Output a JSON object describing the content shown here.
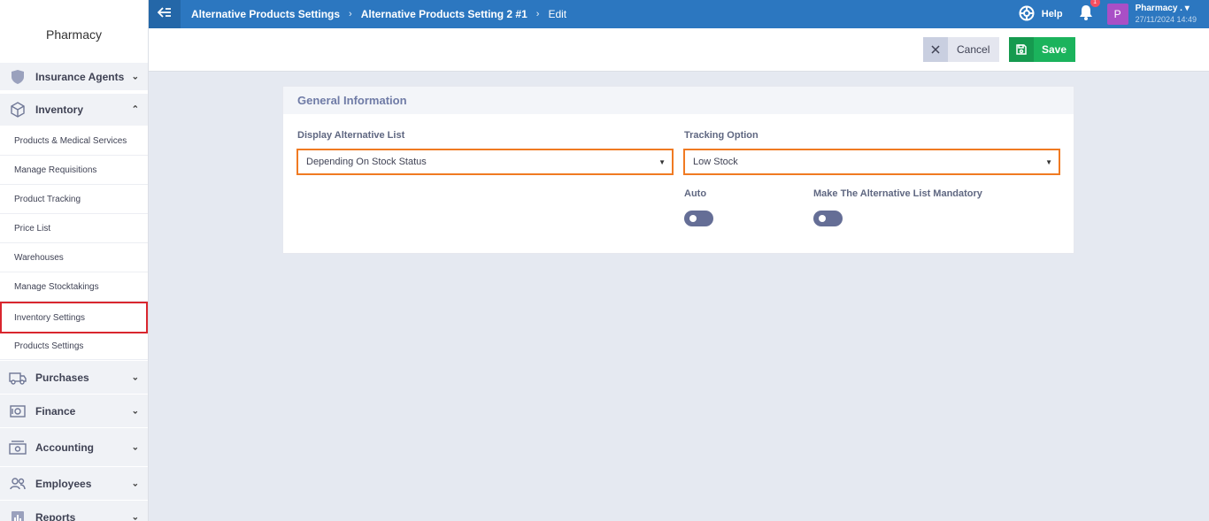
{
  "sidebar": {
    "brand": "Pharmacy",
    "items": [
      {
        "label": "Insurance Agents",
        "icon": "shield-icon"
      },
      {
        "label": "Inventory",
        "icon": "box-icon"
      },
      {
        "label": "Purchases",
        "icon": "truck-icon"
      },
      {
        "label": "Finance",
        "icon": "safe-icon"
      },
      {
        "label": "Accounting",
        "icon": "cash-icon"
      },
      {
        "label": "Employees",
        "icon": "people-icon"
      },
      {
        "label": "Reports",
        "icon": "chart-icon"
      }
    ],
    "sub_items": [
      {
        "label": "Products & Medical Services"
      },
      {
        "label": "Manage Requisitions"
      },
      {
        "label": "Product Tracking"
      },
      {
        "label": "Price List"
      },
      {
        "label": "Warehouses"
      },
      {
        "label": "Manage Stocktakings"
      },
      {
        "label": "Inventory Settings"
      },
      {
        "label": "Products Settings"
      }
    ]
  },
  "topbar": {
    "breadcrumbs": [
      "Alternative Products Settings",
      "Alternative Products Setting 2 #1",
      "Edit"
    ],
    "help": "Help",
    "notification_count": "1",
    "avatar_letter": "P",
    "user_name": "Pharmacy .",
    "datetime": "27/11/2024 14:49"
  },
  "actions": {
    "cancel": "Cancel",
    "save": "Save"
  },
  "form": {
    "section_title": "General Information",
    "display_label": "Display Alternative List",
    "display_value": "Depending On Stock Status",
    "tracking_label": "Tracking Option",
    "tracking_value": "Low Stock",
    "auto_label": "Auto",
    "mandatory_label": "Make The Alternative List Mandatory"
  },
  "colors": {
    "topbar": "#2c77c0",
    "save": "#1bb35c",
    "select_border": "#f07a22",
    "active_outline": "#d9262e",
    "toggle": "#656e96"
  }
}
